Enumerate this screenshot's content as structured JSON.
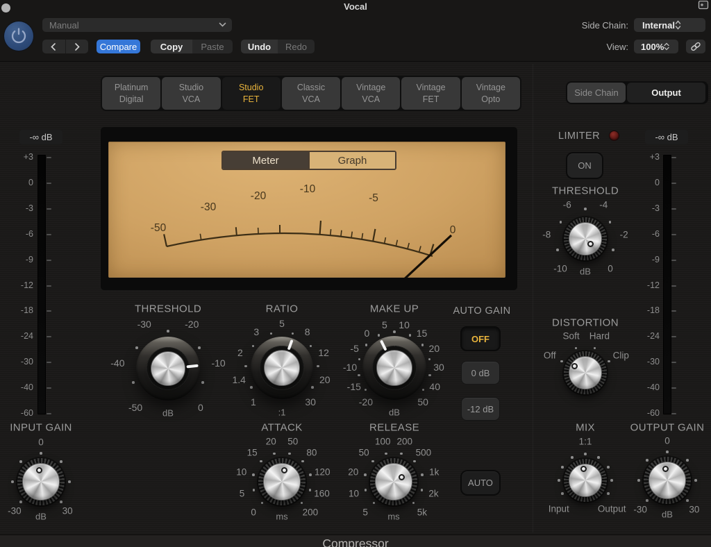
{
  "header": {
    "title": "Vocal",
    "preset_value": "Manual",
    "compare": "Compare",
    "copy": "Copy",
    "paste": "Paste",
    "undo": "Undo",
    "redo": "Redo",
    "side_chain_label": "Side Chain:",
    "side_chain_value": "Internal",
    "view_label": "View:",
    "view_value": "100%"
  },
  "circuit_tabs": {
    "items": [
      {
        "lines": [
          "Platinum",
          "Digital"
        ],
        "selected": false
      },
      {
        "lines": [
          "Studio",
          "VCA"
        ],
        "selected": false
      },
      {
        "lines": [
          "Studio",
          "FET"
        ],
        "selected": true
      },
      {
        "lines": [
          "Classic",
          "VCA"
        ],
        "selected": false
      },
      {
        "lines": [
          "Vintage",
          "VCA"
        ],
        "selected": false
      },
      {
        "lines": [
          "Vintage",
          "FET"
        ],
        "selected": false
      },
      {
        "lines": [
          "Vintage",
          "Opto"
        ],
        "selected": false
      }
    ]
  },
  "output_toggle": {
    "options": [
      {
        "label": "Side Chain",
        "selected": false
      },
      {
        "label": "Output",
        "selected": true
      }
    ]
  },
  "vu_meter": {
    "tabs": [
      {
        "label": "Meter",
        "selected": true
      },
      {
        "label": "Graph",
        "selected": false
      }
    ],
    "scale_labels": [
      "-50",
      "-30",
      "-20",
      "-10",
      "-5",
      "0"
    ]
  },
  "meters": {
    "left": {
      "readout": "-∞ dB",
      "scale": [
        "+3",
        "0",
        "-3",
        "-6",
        "-9",
        "-12",
        "-18",
        "-24",
        "-30",
        "-40",
        "-60"
      ]
    },
    "right": {
      "readout": "-∞ dB",
      "scale": [
        "+3",
        "0",
        "-3",
        "-6",
        "-9",
        "-12",
        "-18",
        "-24",
        "-30",
        "-40",
        "-60"
      ]
    }
  },
  "knobs": {
    "threshold": {
      "title": "THRESHOLD",
      "ticks": [
        "-50",
        "-40",
        "-30",
        "-20",
        "-10",
        "0"
      ],
      "unit": "dB"
    },
    "ratio": {
      "title": "RATIO",
      "ticks": [
        "1",
        "1.4",
        "2",
        "3",
        "5",
        "8",
        "12",
        "20",
        "30"
      ],
      "unit": ":1"
    },
    "makeup": {
      "title": "MAKE UP",
      "ticks": [
        "-20",
        "-15",
        "-10",
        "-5",
        "0",
        "5",
        "10",
        "15",
        "20",
        "30",
        "40",
        "50"
      ],
      "unit": "dB"
    },
    "input_gain": {
      "title": "INPUT GAIN",
      "ticks": [
        "-30",
        "0",
        "30"
      ],
      "unit": "dB"
    },
    "attack": {
      "title": "ATTACK",
      "ticks": [
        "0",
        "5",
        "10",
        "15",
        "20",
        "50",
        "80",
        "120",
        "160",
        "200"
      ],
      "unit": "ms"
    },
    "release": {
      "title": "RELEASE",
      "ticks": [
        "5",
        "10",
        "20",
        "50",
        "100",
        "200",
        "500",
        "1k",
        "2k",
        "5k"
      ],
      "unit": "ms"
    },
    "limiter_threshold": {
      "title": "THRESHOLD",
      "ticks": [
        "-10",
        "-8",
        "-6",
        "-4",
        "-2",
        "0"
      ],
      "unit": "dB"
    },
    "distortion": {
      "title": "DISTORTION",
      "ticks": [
        "Off",
        "Soft",
        "Hard",
        "Clip"
      ]
    },
    "mix": {
      "title": "MIX",
      "ticks": [
        "Input",
        "1:1",
        "Output"
      ]
    },
    "output_gain": {
      "title": "OUTPUT GAIN",
      "ticks": [
        "-30",
        "0",
        "30"
      ],
      "unit": "dB"
    }
  },
  "auto_gain": {
    "label": "AUTO GAIN",
    "options": [
      {
        "label": "OFF",
        "selected": true
      },
      {
        "label": "0 dB",
        "selected": false
      },
      {
        "label": "-12 dB",
        "selected": false
      }
    ]
  },
  "limiter": {
    "label": "LIMITER",
    "on_label": "ON"
  },
  "release_auto": {
    "label": "AUTO"
  },
  "footer": {
    "plugin_name": "Compressor"
  },
  "colors": {
    "accent_yellow": "#e9b43c",
    "accent_blue": "#3577d8",
    "vu_gold": "#cfa263",
    "led_red": "#551512"
  }
}
